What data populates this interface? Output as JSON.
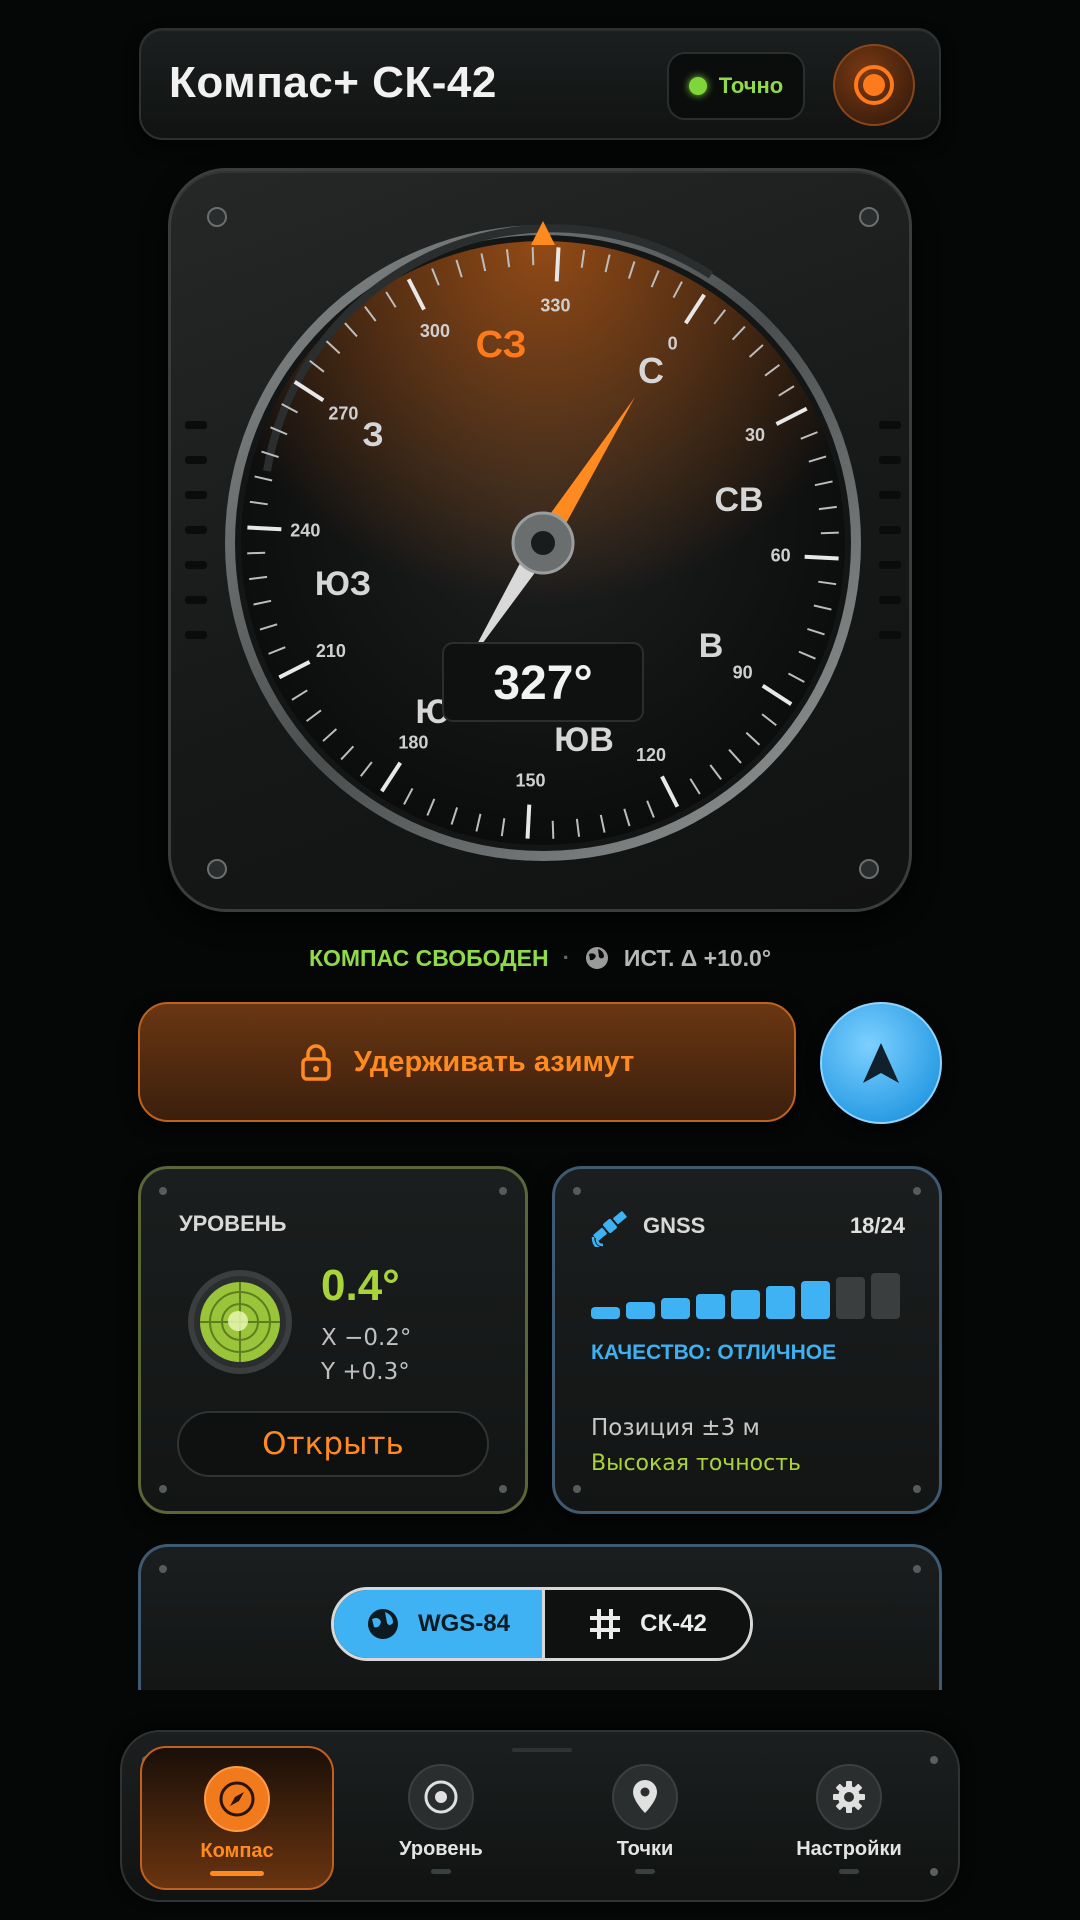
{
  "header": {
    "title": "Компас+ СК-42",
    "status_label": "Точно",
    "status_color": "#7fd63a",
    "record_icon": "record-icon"
  },
  "compass": {
    "heading_value": "327°",
    "needle_color": "#ff8a1f",
    "ticks": [
      "0",
      "30",
      "60",
      "90",
      "120",
      "150",
      "180",
      "210",
      "240",
      "270",
      "300",
      "330"
    ],
    "cardinals": {
      "n": "С",
      "ne": "СВ",
      "e": "В",
      "se": "ЮВ",
      "s": "Ю",
      "sw": "ЮЗ",
      "w": "З",
      "nw": "СЗ"
    }
  },
  "status_line": {
    "state": "КОМПАС СВОБОДЕН",
    "separator": "·",
    "declination": "ИСТ. Δ +10.0°"
  },
  "hold_button": {
    "label": "Удерживать азимут"
  },
  "level": {
    "title": "УРОВЕНЬ",
    "value": "0.4°",
    "x": "X −0.2°",
    "y": "Y +0.3°",
    "open_label": "Открыть"
  },
  "gnss": {
    "title": "GNSS",
    "satellites": "18/24",
    "signal_bars_active": 7,
    "signal_bars_total": 9,
    "quality": "КАЧЕСТВО: ОТЛИЧНОЕ",
    "position": "Позиция ±3 м",
    "accuracy": "Высокая точность"
  },
  "datum": {
    "options": [
      {
        "label": "WGS-84",
        "icon": "globe-icon",
        "selected": true
      },
      {
        "label": "СК-42",
        "icon": "grid-icon",
        "selected": false
      }
    ]
  },
  "bottom_nav": {
    "items": [
      {
        "label": "Компас",
        "icon": "compass-icon",
        "active": true
      },
      {
        "label": "Уровень",
        "icon": "target-icon",
        "active": false
      },
      {
        "label": "Точки",
        "icon": "pin-icon",
        "active": false
      },
      {
        "label": "Настройки",
        "icon": "gear-icon",
        "active": false
      }
    ]
  },
  "colors": {
    "accent": "#ff8a1f",
    "green": "#a8d43a",
    "blue": "#3eb2f2"
  }
}
